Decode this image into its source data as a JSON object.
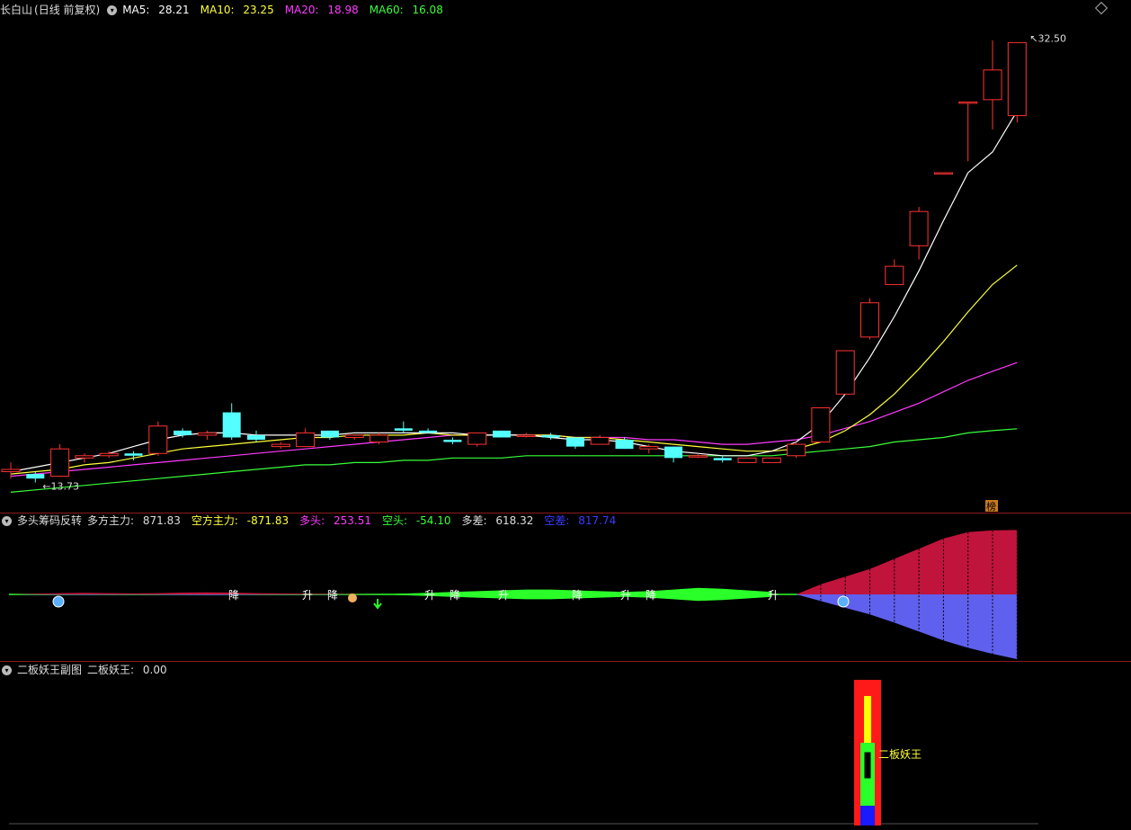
{
  "main": {
    "stock_name": "长白山",
    "period": "(日线 前复权)",
    "ma": [
      {
        "label": "MA5:",
        "value": "28.21",
        "color": "#ffffff"
      },
      {
        "label": "MA10:",
        "value": "23.25",
        "color": "#ffff3a"
      },
      {
        "label": "MA20:",
        "value": "18.98",
        "color": "#ff3aff"
      },
      {
        "label": "MA60:",
        "value": "16.08",
        "color": "#3aff3a"
      }
    ],
    "high_label": "32.50",
    "low_label": "13.73",
    "bang_label": "榜"
  },
  "indicator1": {
    "name": "多头筹码反转",
    "items": [
      {
        "label": "多方主力:",
        "value": "871.83",
        "color": "#dddddd"
      },
      {
        "label": "空方主力:",
        "value": "-871.83",
        "color": "#ffff3a"
      },
      {
        "label": "多头:",
        "value": "253.51",
        "color": "#ff3aff"
      },
      {
        "label": "空头:",
        "value": "-54.10",
        "color": "#3aff3a"
      },
      {
        "label": "多差:",
        "value": "618.32",
        "color": "#dddddd"
      },
      {
        "label": "空差:",
        "value": "817.74",
        "color": "#3a3aff"
      }
    ],
    "marks": [
      "降",
      "升",
      "降",
      "升",
      "降",
      "升",
      "降",
      "升",
      "降",
      "升"
    ]
  },
  "indicator2": {
    "name": "二板妖王副图",
    "label": "二板妖王:",
    "value": "0.00",
    "signal_label": "二板妖王"
  },
  "chart_data": {
    "type": "candlestick",
    "ylim": [
      13.0,
      34.0
    ],
    "candles": [
      [
        14.2,
        14.6,
        13.9,
        14.3
      ],
      [
        14.1,
        14.2,
        13.73,
        13.9
      ],
      [
        14.0,
        15.4,
        14.0,
        15.2
      ],
      [
        14.8,
        15.0,
        14.6,
        14.9
      ],
      [
        14.9,
        15.1,
        14.8,
        15.0
      ],
      [
        15.0,
        15.1,
        14.7,
        14.9
      ],
      [
        15.0,
        16.4,
        14.9,
        16.2
      ],
      [
        16.0,
        16.1,
        15.7,
        15.8
      ],
      [
        15.8,
        16.0,
        15.6,
        15.9
      ],
      [
        16.8,
        17.2,
        15.6,
        15.7
      ],
      [
        15.8,
        16.0,
        15.5,
        15.6
      ],
      [
        15.3,
        15.5,
        15.2,
        15.4
      ],
      [
        15.3,
        16.1,
        15.3,
        15.9
      ],
      [
        16.0,
        16.0,
        15.6,
        15.7
      ],
      [
        15.7,
        15.8,
        15.6,
        15.8
      ],
      [
        15.5,
        15.9,
        15.4,
        15.8
      ],
      [
        16.1,
        16.4,
        15.9,
        16.0
      ],
      [
        16.0,
        16.1,
        15.9,
        15.9
      ],
      [
        15.6,
        15.7,
        15.4,
        15.5
      ],
      [
        15.4,
        15.9,
        15.3,
        15.9
      ],
      [
        16.0,
        16.0,
        15.7,
        15.7
      ],
      [
        15.8,
        15.9,
        15.7,
        15.8
      ],
      [
        15.8,
        15.9,
        15.6,
        15.7
      ],
      [
        15.7,
        15.7,
        15.2,
        15.3
      ],
      [
        15.4,
        15.8,
        15.4,
        15.7
      ],
      [
        15.6,
        15.7,
        15.2,
        15.2
      ],
      [
        15.2,
        15.4,
        15.0,
        15.3
      ],
      [
        15.3,
        15.3,
        14.6,
        14.8
      ],
      [
        14.9,
        15.0,
        14.8,
        14.9
      ],
      [
        14.8,
        14.9,
        14.6,
        14.7
      ],
      [
        14.6,
        14.8,
        14.6,
        14.8
      ],
      [
        14.6,
        14.8,
        14.6,
        14.8
      ],
      [
        14.9,
        15.5,
        14.8,
        15.4
      ],
      [
        15.5,
        17.0,
        15.5,
        17.0
      ],
      [
        17.6,
        19.5,
        17.6,
        19.5
      ],
      [
        20.1,
        21.8,
        20.0,
        21.6
      ],
      [
        22.4,
        23.5,
        22.4,
        23.2
      ],
      [
        24.1,
        25.8,
        23.5,
        25.6
      ],
      [
        27.3,
        27.3,
        27.3,
        27.3
      ],
      [
        30.4,
        30.4,
        27.8,
        30.4
      ],
      [
        30.5,
        33.1,
        29.2,
        31.8
      ],
      [
        29.8,
        32.5,
        29.5,
        33.0
      ]
    ],
    "ma5": [
      14.2,
      14.4,
      14.6,
      14.8,
      15.0,
      15.3,
      15.6,
      15.8,
      15.9,
      15.9,
      15.8,
      15.8,
      15.8,
      15.8,
      15.9,
      15.9,
      15.9,
      15.9,
      15.9,
      15.8,
      15.8,
      15.8,
      15.7,
      15.6,
      15.6,
      15.5,
      15.3,
      15.1,
      15.0,
      14.9,
      14.9,
      15.1,
      15.5,
      16.3,
      17.6,
      19.2,
      21.0,
      23.0,
      25.2,
      27.3,
      28.21,
      30.0
    ],
    "ma10": [
      14.1,
      14.2,
      14.3,
      14.5,
      14.6,
      14.8,
      15.0,
      15.2,
      15.3,
      15.4,
      15.5,
      15.6,
      15.7,
      15.7,
      15.8,
      15.8,
      15.8,
      15.9,
      15.8,
      15.8,
      15.8,
      15.8,
      15.8,
      15.7,
      15.7,
      15.6,
      15.5,
      15.4,
      15.3,
      15.2,
      15.1,
      15.1,
      15.2,
      15.5,
      16.0,
      16.7,
      17.6,
      18.7,
      19.9,
      21.2,
      22.4,
      23.25
    ],
    "ma20": [
      14.0,
      14.1,
      14.2,
      14.3,
      14.4,
      14.5,
      14.6,
      14.7,
      14.8,
      14.9,
      15.0,
      15.1,
      15.2,
      15.3,
      15.4,
      15.5,
      15.6,
      15.7,
      15.8,
      15.8,
      15.8,
      15.8,
      15.8,
      15.7,
      15.7,
      15.7,
      15.6,
      15.6,
      15.5,
      15.4,
      15.4,
      15.5,
      15.6,
      15.8,
      16.1,
      16.4,
      16.8,
      17.2,
      17.7,
      18.2,
      18.6,
      18.98
    ],
    "ma60": [
      13.3,
      13.4,
      13.5,
      13.6,
      13.7,
      13.8,
      13.9,
      14.0,
      14.1,
      14.2,
      14.3,
      14.4,
      14.5,
      14.5,
      14.6,
      14.6,
      14.7,
      14.7,
      14.8,
      14.8,
      14.8,
      14.9,
      14.9,
      14.9,
      14.9,
      14.9,
      14.9,
      14.9,
      14.9,
      14.9,
      14.9,
      14.9,
      15.0,
      15.1,
      15.2,
      15.3,
      15.5,
      15.6,
      15.7,
      15.9,
      16.0,
      16.08
    ],
    "ind1_long": [
      0,
      3,
      5,
      6,
      5,
      4,
      5,
      7,
      8,
      7,
      5,
      4,
      3,
      2,
      1,
      0,
      -1,
      -2,
      -3,
      -4,
      -5,
      -6,
      -6,
      -5,
      -4,
      -3,
      -4,
      -6,
      -8,
      -7,
      -5,
      -3,
      0,
      40,
      70,
      100,
      140,
      180,
      220,
      245,
      252,
      253.51
    ],
    "ind1_short": [
      0,
      -3,
      -5,
      -6,
      -5,
      -4,
      -5,
      -7,
      -8,
      -7,
      -5,
      -4,
      -3,
      -2,
      -1,
      0,
      1,
      2,
      3,
      4,
      5,
      6,
      6,
      5,
      4,
      3,
      4,
      6,
      8,
      7,
      5,
      3,
      0,
      -90,
      -180,
      -270,
      -380,
      -500,
      -620,
      -720,
      -800,
      -871.83
    ]
  }
}
